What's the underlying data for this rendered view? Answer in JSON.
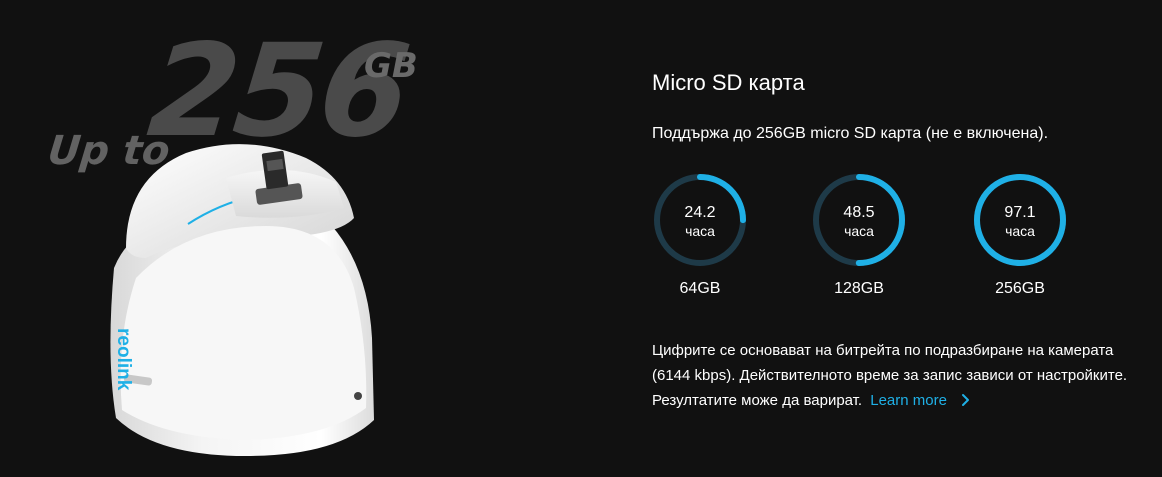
{
  "hero": {
    "capacity": "256",
    "unit": "GB",
    "prefix": "Up to",
    "brand": "reolink"
  },
  "section": {
    "title": "Micro SD карта",
    "subtitle": "Поддържа до 256GB micro SD карта (не е включена)."
  },
  "gauges": [
    {
      "value": "24.2",
      "unit": "часа",
      "label": "64GB",
      "fill": 0.25
    },
    {
      "value": "48.5",
      "unit": "часа",
      "label": "128GB",
      "fill": 0.5
    },
    {
      "value": "97.1",
      "unit": "часа",
      "label": "256GB",
      "fill": 1.0
    }
  ],
  "note": {
    "line1": "Цифрите се основават на битрейта по подразбиране на камерата",
    "line2": "(6144 kbps). Действителното време за запис зависи от настройките.",
    "line3": "Резултатите може да варират.",
    "link_label": "Learn more"
  },
  "colors": {
    "background": "#111111",
    "accent": "#1fb0e6",
    "track": "#1e3a48"
  }
}
